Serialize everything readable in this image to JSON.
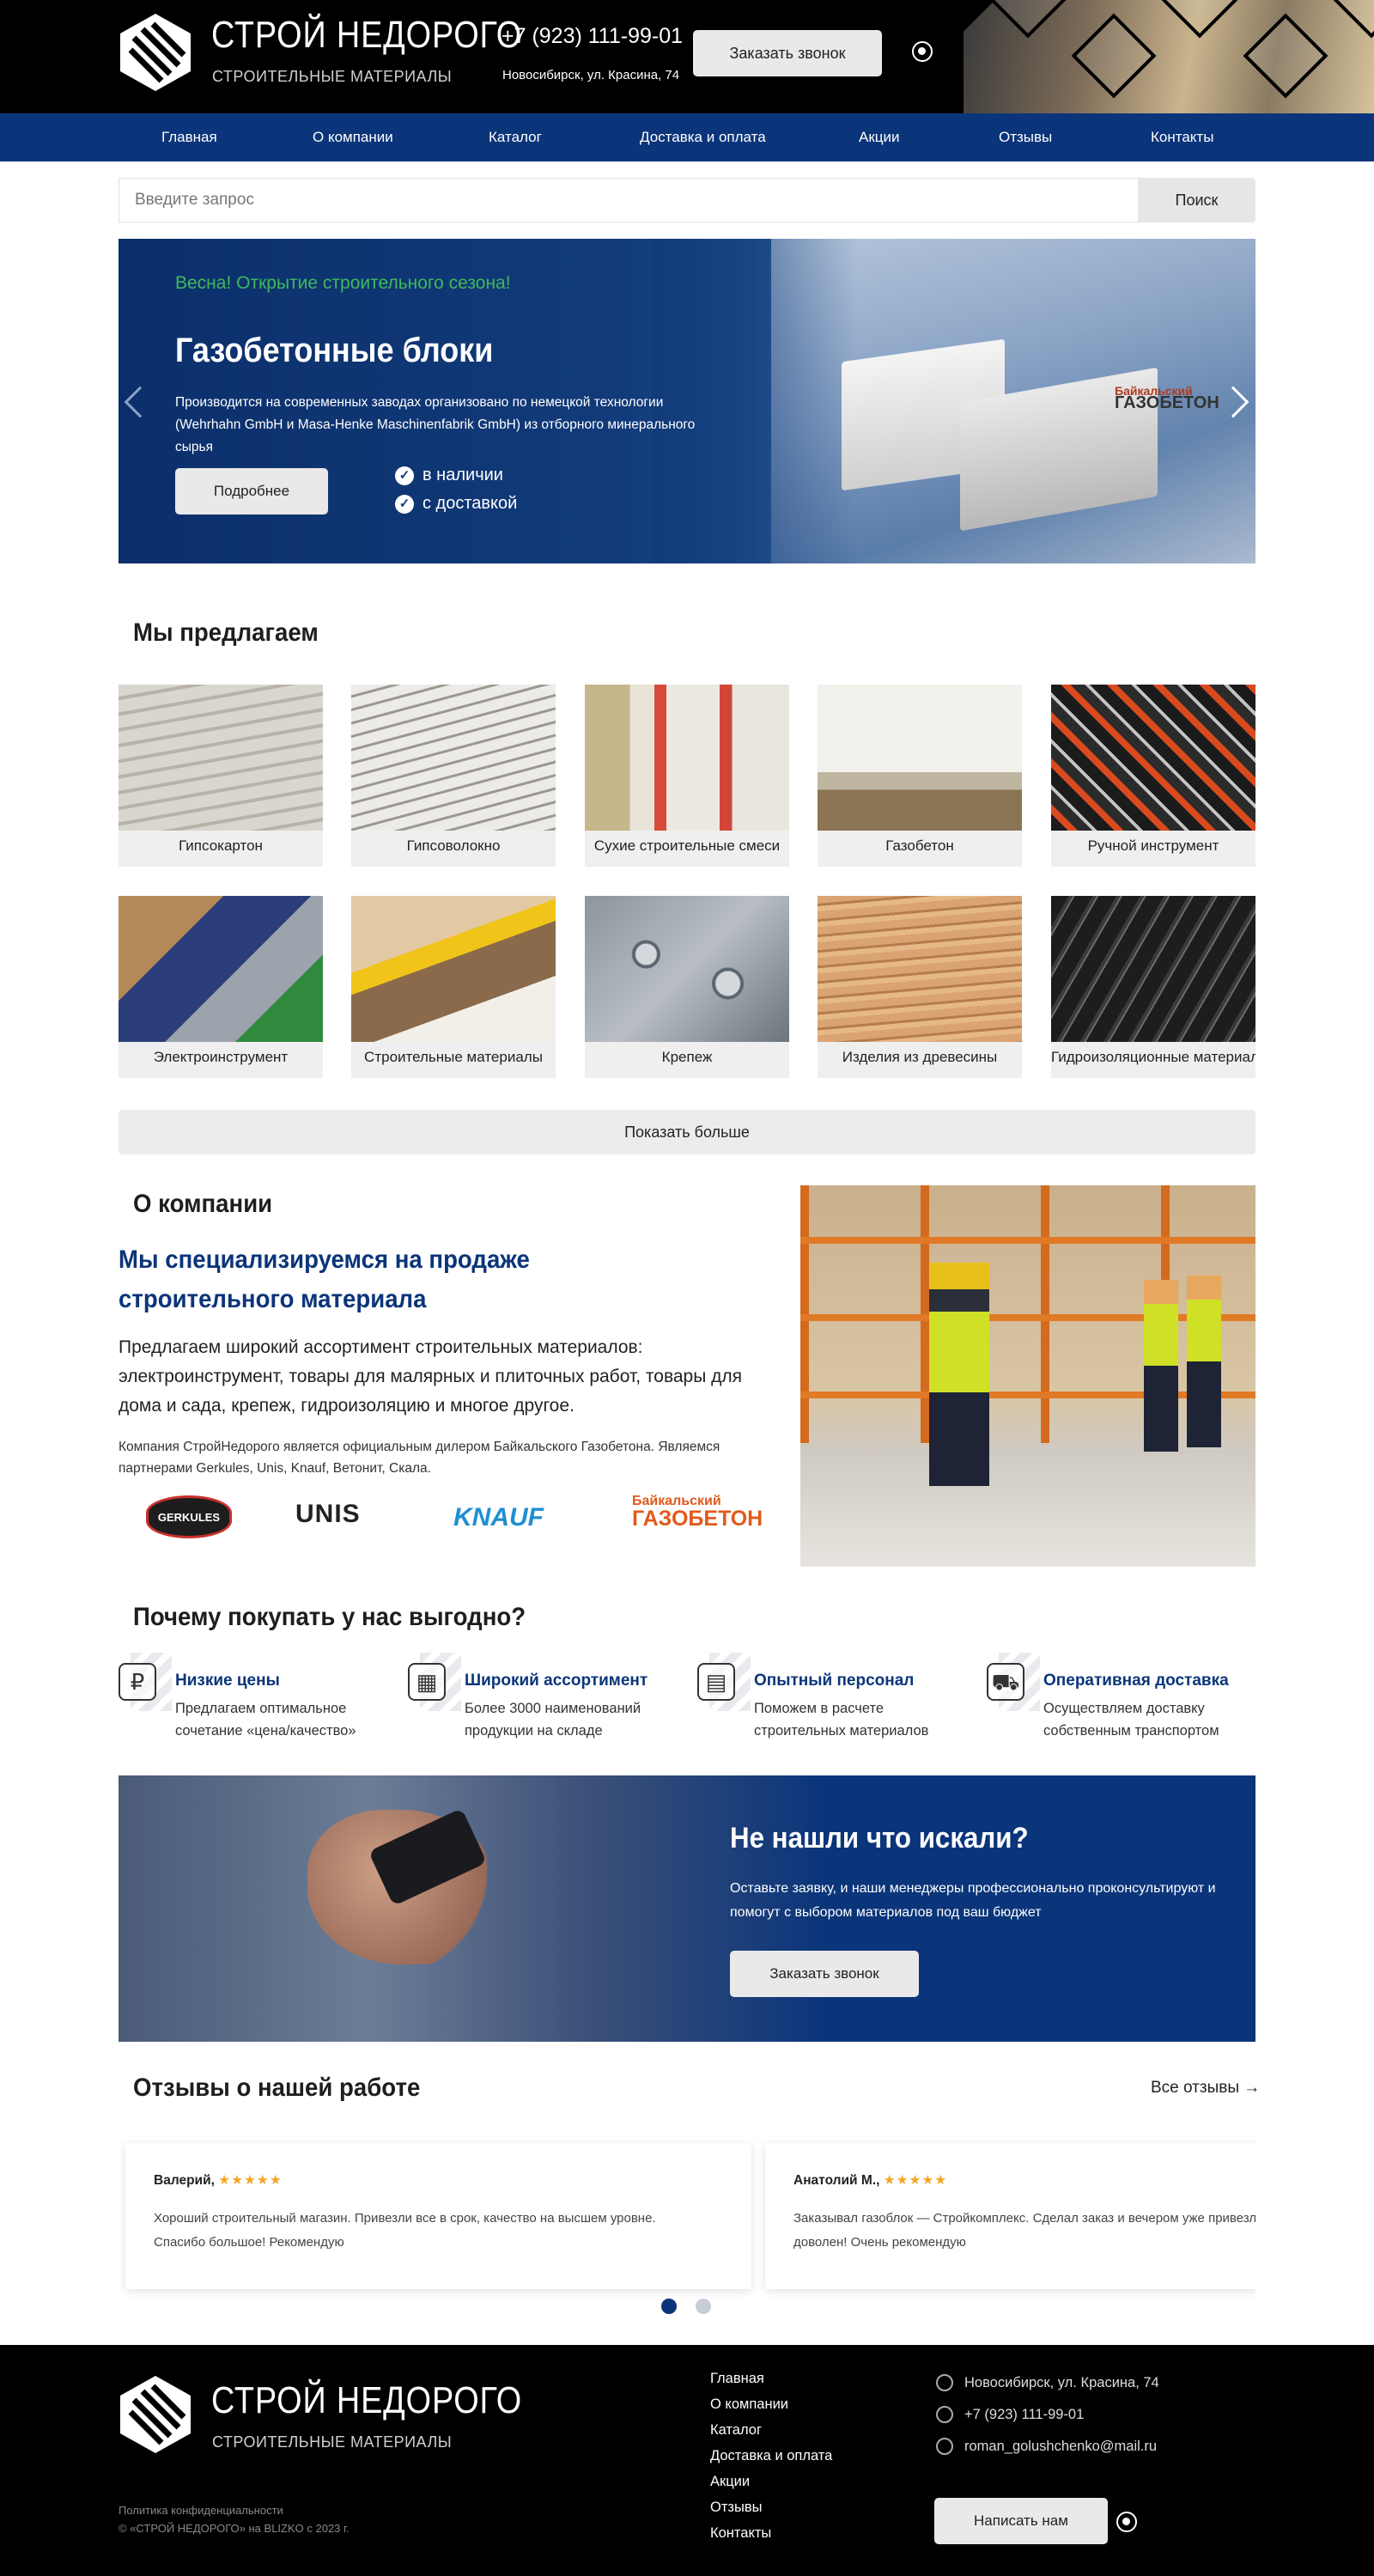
{
  "header": {
    "logo_title": "СТРОЙ НЕДОРОГО",
    "logo_subtitle": "СТРОИТЕЛЬНЫЕ МАТЕРИАЛЫ",
    "phone": "+7 (923) 111-99-01",
    "address": "Новосибирск, ул. Красина, 74",
    "callback_button": "Заказать звонок",
    "messenger_icon": "whatsapp-icon"
  },
  "nav": {
    "items": [
      "Главная",
      "О компании",
      "Каталог",
      "Доставка и оплата",
      "Акции",
      "Отзывы",
      "Контакты"
    ]
  },
  "search": {
    "placeholder": "Введите запрос",
    "button": "Поиск"
  },
  "hero": {
    "kicker": "Весна! Открытие строительного сезона!",
    "title": "Газобетонные блоки",
    "description": "Производится на современных заводах организовано по немецкой технологии (Wehrhahn GmbH и Masa-Henke Maschinenfabrik GmbH) из отборного минерального сырья",
    "more_button": "Подробнее",
    "features": [
      "в наличии",
      "с доставкой"
    ],
    "brand_mark_line1": "Байкальский",
    "brand_mark_line2": "ГАЗОБЕТОН"
  },
  "offer": {
    "title": "Мы предлагаем",
    "items": [
      "Гипсокартон",
      "Гипсоволокно",
      "Сухие строительные смеси",
      "Газобетон",
      "Ручной инструмент",
      "Электроинструмент",
      "Строительные материалы",
      "Крепеж",
      "Изделия из древесины",
      "Гидроизоляционные материалы"
    ],
    "more_button": "Показать больше"
  },
  "about": {
    "title": "О компании",
    "headline": "Мы специализируемся на продаже строительного материала",
    "lead": "Предлагаем широкий ассортимент строительных материалов: электроинструмент, товары для малярных и плиточных работ, товары для дома и сада, крепеж, гидроизоляцию и многое другое.",
    "note": "Компания СтройНедорого является официальным дилером Байкальского Газобетона. Являемся партнерами Gerkules, Unis, Knauf, Ветонит, Скала.",
    "partners": [
      "GERKULES",
      "UNIS",
      "KNAUF",
      "ГАЗОБЕТОН"
    ],
    "partner_gazobeton_top": "Байкальский"
  },
  "why": {
    "title": "Почему покупать у нас выгодно?",
    "items": [
      {
        "title": "Низкие цены",
        "text": "Предлагаем оптимальное сочетание «цена/качество»",
        "icon": "coins-icon"
      },
      {
        "title": "Широкий ассортимент",
        "text": "Более 3000 наименований продукции на складе",
        "icon": "warehouse-icon"
      },
      {
        "title": "Опытный персонал",
        "text": "Поможем в расчете строительных материалов",
        "icon": "calculator-icon"
      },
      {
        "title": "Оперативная доставка",
        "text": "Осуществляем доставку собственным транспортом",
        "icon": "truck-icon"
      }
    ]
  },
  "cta": {
    "title": "Не нашли что искали?",
    "text": "Оставьте заявку, и наши менеджеры профессионально проконсультируют и помогут с выбором материалов под ваш бюджет",
    "button": "Заказать звонок"
  },
  "reviews": {
    "title": "Отзывы о нашей работе",
    "all_link": "Все отзывы",
    "stars": "★★★★★",
    "items": [
      {
        "name": "Валерий,",
        "text": "Хороший строительный магазин. Привезли все в срок, качество на высшем уровне. Спасибо большое! Рекомендую"
      },
      {
        "name": "Анатолий М.,",
        "text": "Заказывал газоблок — Стройкомплекс. Сделал заказ и вечером уже привезли, спасибо, доволен! Очень рекомендую"
      }
    ]
  },
  "footer": {
    "logo_title": "СТРОЙ НЕДОРОГО",
    "logo_subtitle": "СТРОИТЕЛЬНЫЕ МАТЕРИАЛЫ",
    "policy": "Политика конфиденциальности",
    "copyright": "© «СТРОЙ НЕДОРОГО» на BLIZKO с 2023 г.",
    "links": [
      "Главная",
      "О компании",
      "Каталог",
      "Доставка и оплата",
      "Акции",
      "Отзывы",
      "Контакты"
    ],
    "address": "Новосибирск, ул. Красина, 74",
    "phone": "+7 (923) 111-99-01",
    "email": "roman_golushchenko@mail.ru",
    "write_button": "Написать нам"
  },
  "colors": {
    "brand_blue": "#0b357a",
    "accent_green": "#3fb95b",
    "star": "#f5a623",
    "header_bg": "#000000"
  }
}
